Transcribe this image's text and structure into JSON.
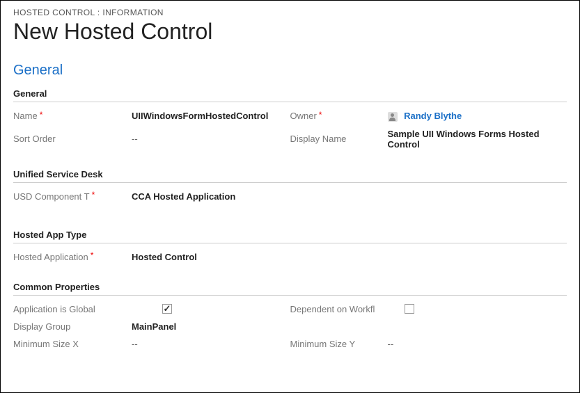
{
  "breadcrumb": "HOSTED CONTROL : INFORMATION",
  "page_title": "New Hosted Control",
  "tab": "General",
  "sections": {
    "general": {
      "header": "General",
      "name_label": "Name",
      "name_value": "UIIWindowsFormHostedControl",
      "sort_order_label": "Sort Order",
      "sort_order_value": "--",
      "owner_label": "Owner",
      "owner_value": "Randy Blythe",
      "display_name_label": "Display Name",
      "display_name_value": "Sample UII Windows Forms Hosted Control"
    },
    "usd": {
      "header": "Unified Service Desk",
      "component_type_label": "USD Component T",
      "component_type_value": "CCA Hosted Application"
    },
    "hosted_app": {
      "header": "Hosted App Type",
      "hosted_application_label": "Hosted Application",
      "hosted_application_value": "Hosted Control"
    },
    "common": {
      "header": "Common Properties",
      "app_global_label": "Application is Global",
      "app_global_checked": true,
      "dep_workflow_label": "Dependent on Workfl",
      "dep_workflow_checked": false,
      "display_group_label": "Display Group",
      "display_group_value": "MainPanel",
      "min_x_label": "Minimum Size X",
      "min_x_value": "--",
      "min_y_label": "Minimum Size Y",
      "min_y_value": "--"
    }
  }
}
